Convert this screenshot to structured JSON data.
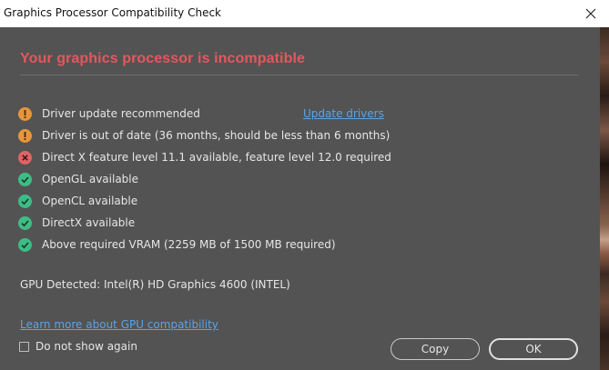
{
  "window": {
    "title": "Graphics Processor Compatibility Check"
  },
  "dialog": {
    "heading": "Your graphics processor is incompatible",
    "checks": [
      {
        "status": "warning",
        "icon": "warning-icon",
        "text": "Driver update recommended",
        "link": "Update drivers"
      },
      {
        "status": "warning",
        "icon": "warning-icon",
        "text": "Driver is out of date (36 months, should be less than 6 months)"
      },
      {
        "status": "error",
        "icon": "error-icon",
        "text": "Direct X feature level 11.1 available, feature level 12.0 required"
      },
      {
        "status": "ok",
        "icon": "check-icon",
        "text": "OpenGL available"
      },
      {
        "status": "ok",
        "icon": "check-icon",
        "text": "OpenCL available"
      },
      {
        "status": "ok",
        "icon": "check-icon",
        "text": "DirectX available"
      },
      {
        "status": "ok",
        "icon": "check-icon",
        "text": "Above required VRAM (2259 MB of 1500 MB required)"
      }
    ],
    "gpu_detected": "GPU Detected: Intel(R) HD Graphics 4600 (INTEL)",
    "learn_more_link": "Learn more about GPU compatibility",
    "do_not_show_label": "Do not show again",
    "do_not_show_checked": false,
    "copy_button": "Copy",
    "ok_button": "OK"
  },
  "colors": {
    "heading": "#e5575e",
    "warning": "#e8953a",
    "error": "#e06465",
    "ok": "#3dbd86",
    "link": "#5aa3e8",
    "dialog_bg": "#535353"
  }
}
